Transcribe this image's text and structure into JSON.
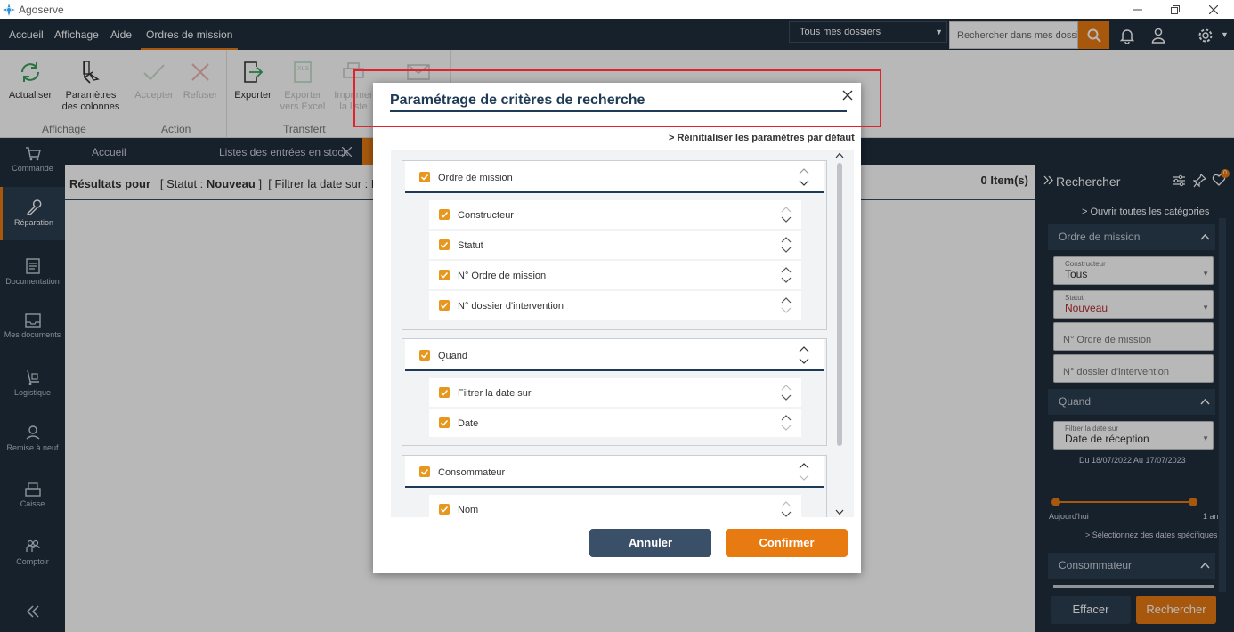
{
  "app": {
    "title": "Agoserve"
  },
  "menu": {
    "items": [
      "Accueil",
      "Affichage",
      "Aide",
      "Ordres de mission"
    ],
    "active": "Ordres de mission"
  },
  "header": {
    "dossier_select": "Tous mes dossiers",
    "search_placeholder": "Rechercher dans mes dossiers"
  },
  "ribbon": {
    "refresh": "Actualiser",
    "columns_line1": "Paramètres",
    "columns_line2": "des colonnes",
    "accept": "Accepter",
    "refuse": "Refuser",
    "export": "Exporter",
    "export_excel_line1": "Exporter",
    "export_excel_line2": "vers Excel",
    "print_line1": "Imprimer",
    "print_line2": "la liste",
    "groups": [
      "Affichage",
      "Action",
      "Transfert"
    ]
  },
  "sidebar": {
    "items": [
      "Commande",
      "Réparation",
      "Documentation",
      "Mes documents",
      "Logistique",
      "Remise à neuf",
      "Caisse",
      "Comptoir"
    ],
    "active": "Réparation"
  },
  "tabs": [
    "Accueil",
    "Listes des entrées en stock"
  ],
  "results": {
    "prefix": "Résultats pour",
    "status_open": "[ Statut :",
    "status_value": "Nouveau",
    "status_close": "]",
    "date_filter": "[ Filtrer la date sur : Da",
    "items": "0 Item(s)"
  },
  "right_panel": {
    "title": "Rechercher",
    "open_all": "> Ouvrir toutes les catégories",
    "sections": [
      "Ordre de mission",
      "Quand",
      "Consommateur"
    ],
    "constructeur_label": "Constructeur",
    "constructeur_value": "Tous",
    "statut_label": "Statut",
    "statut_value": "Nouveau",
    "ordre_placeholder": "N° Ordre de mission",
    "dossier_placeholder": "N° dossier d'intervention",
    "date_label": "Filtrer la date sur",
    "date_value": "Date de réception",
    "date_range": "Du 18/07/2022 Au 17/07/2023",
    "slider_left": "Aujourd'hui",
    "slider_right": "1 an",
    "specific_dates": "> Sélectionnez des dates spécifiques",
    "clear_button": "Effacer",
    "search_button": "Rechercher",
    "notification_count": "0"
  },
  "dialog": {
    "title": "Paramétrage de critères de recherche",
    "reset_link": "> Réinitialiser les paramètres par défaut",
    "groups": [
      {
        "label": "Ordre de mission",
        "items": [
          "Constructeur",
          "Statut",
          "N° Ordre de mission",
          "N° dossier d'intervention"
        ]
      },
      {
        "label": "Quand",
        "items": [
          "Filtrer la date sur",
          "Date"
        ]
      },
      {
        "label": "Consommateur",
        "items": [
          "Nom"
        ]
      }
    ],
    "cancel_button": "Annuler",
    "confirm_button": "Confirmer"
  },
  "colors": {
    "accent": "#e87a12",
    "navy": "#1f2e3d",
    "title": "#1f3a56",
    "highlight": "#e0242c",
    "cancel": "#3a5068"
  }
}
